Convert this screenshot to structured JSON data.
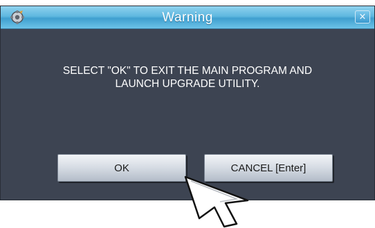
{
  "window": {
    "title": "Warning",
    "close_glyph": "×",
    "app_icon": "gear-app-icon"
  },
  "message": {
    "line1": "SELECT \"OK\" TO EXIT THE MAIN PROGRAM AND",
    "line2": "LAUNCH UPGRADE UTILITY."
  },
  "buttons": {
    "ok_label": "OK",
    "cancel_label": "CANCEL [Enter]"
  },
  "pointer": {
    "icon": "mouse-cursor-icon"
  },
  "colors": {
    "dialog_bg": "#3d4452",
    "titlebar": "#5fb8e0",
    "text": "#ffffff"
  }
}
